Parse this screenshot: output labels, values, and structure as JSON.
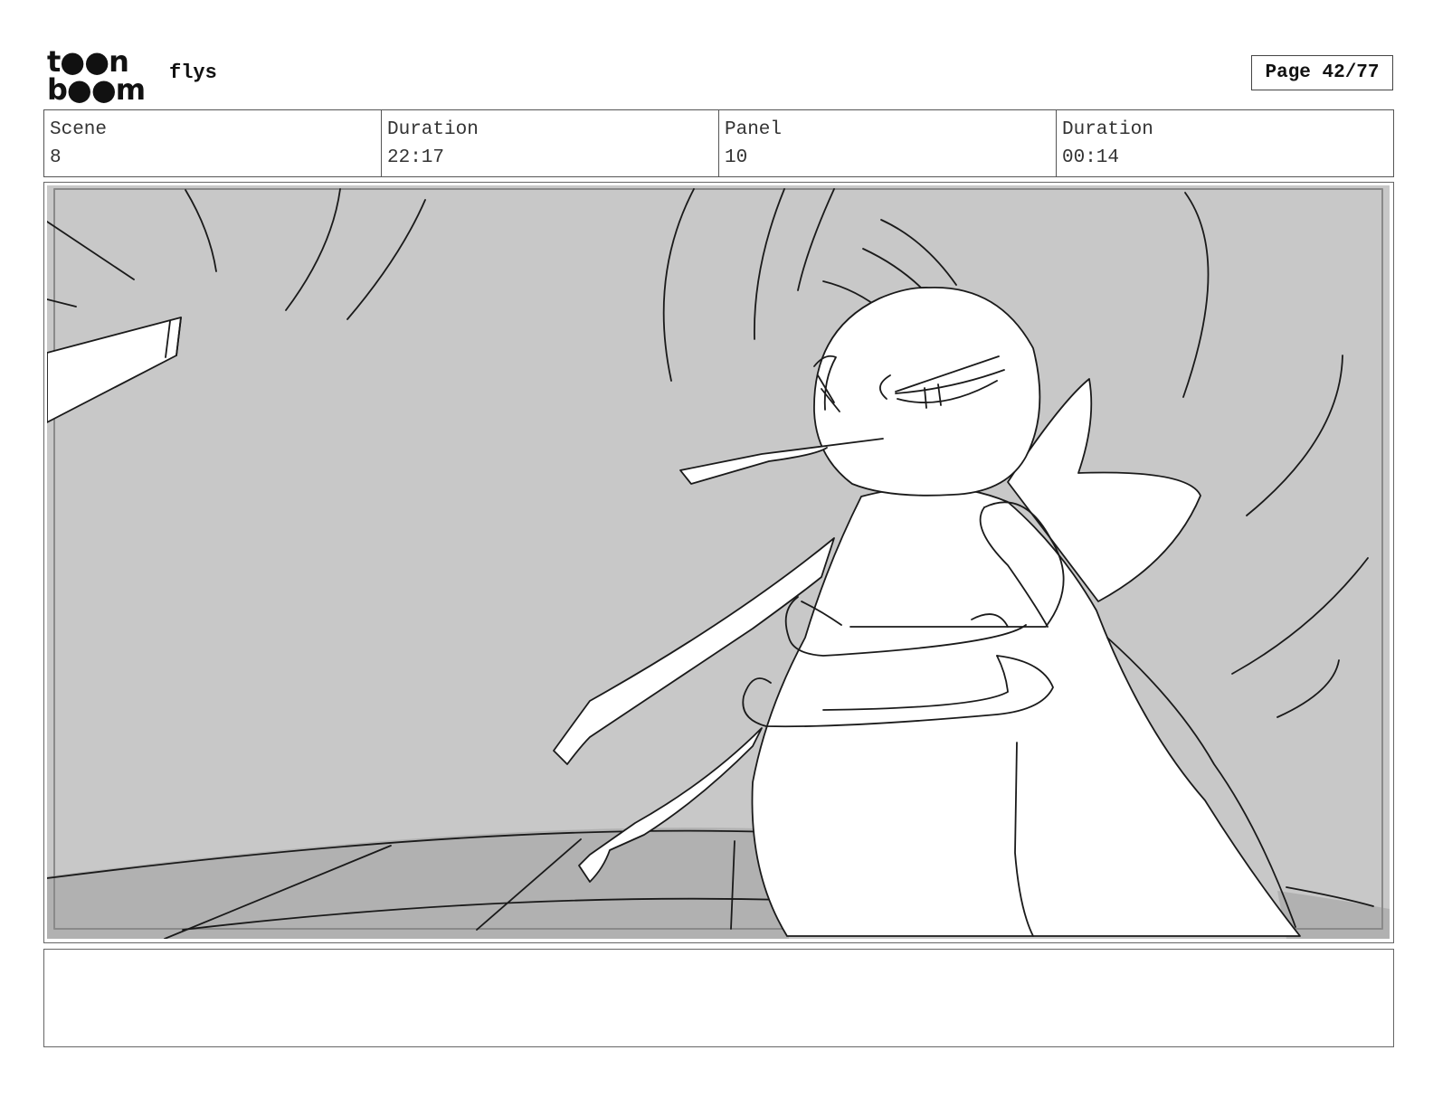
{
  "header": {
    "logo": {
      "line1": "toon",
      "line2": "boom",
      "icon": "toonboom-logo"
    },
    "project_title": "flys",
    "page_label": "Page 42/77"
  },
  "info": {
    "scene_label": "Scene",
    "scene_value": "8",
    "scene_duration_label": "Duration",
    "scene_duration_value": "22:17",
    "panel_label": "Panel",
    "panel_value": "10",
    "panel_duration_label": "Duration",
    "panel_duration_value": "00:14"
  },
  "panel": {
    "colors": {
      "sky": "#c8c8c8",
      "ground": "#b1b1b1",
      "figure": "#ffffff",
      "line": "#1a1a1a"
    }
  },
  "notes": {
    "text": ""
  }
}
